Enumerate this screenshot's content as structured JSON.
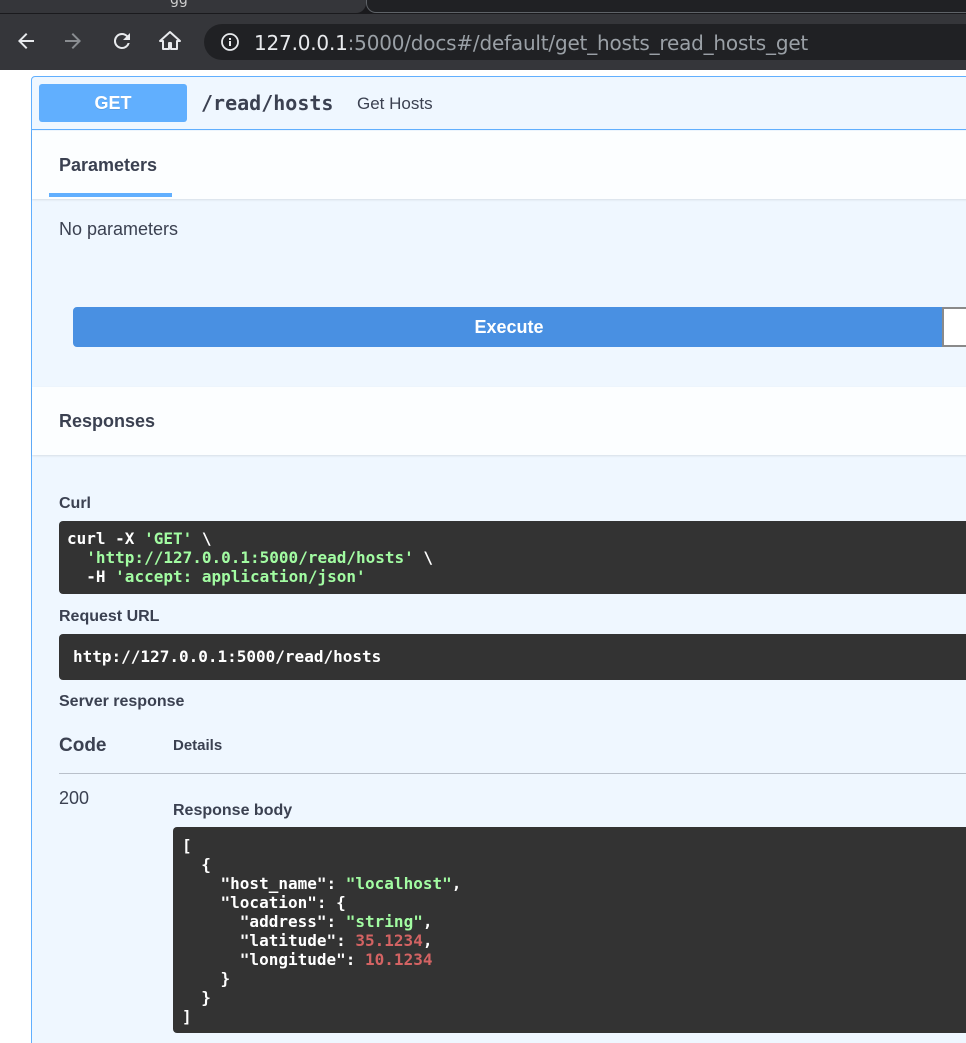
{
  "browser": {
    "tab_title": "gg",
    "url_host": "127.0.0.1",
    "url_rest": ":5000/docs#/default/get_hosts_read_hosts_get"
  },
  "operation": {
    "method": "GET",
    "path": "/read/hosts",
    "summary": "Get Hosts"
  },
  "parameters": {
    "tab_label": "Parameters",
    "empty_text": "No parameters",
    "execute_label": "Execute"
  },
  "responses": {
    "title": "Responses",
    "curl_label": "Curl",
    "curl_lines": [
      {
        "plain": "curl -X ",
        "str": "'GET'",
        "tail": " \\"
      },
      {
        "plain": "  ",
        "str": "'http://127.0.0.1:5000/read/hosts'",
        "tail": " \\"
      },
      {
        "plain": "  -H ",
        "str": "'accept: application/json'",
        "tail": ""
      }
    ],
    "request_url_label": "Request URL",
    "request_url": "http://127.0.0.1:5000/read/hosts",
    "server_response_label": "Server response",
    "col_code": "Code",
    "col_details": "Details",
    "status_code": "200",
    "response_body_label": "Response body",
    "response_body": {
      "open_array": "[",
      "open_obj": "  {",
      "host_name_key": "    \"host_name\": ",
      "host_name_val": "\"localhost\"",
      "location_key": "    \"location\": {",
      "address_key": "      \"address\": ",
      "address_val": "\"string\"",
      "latitude_key": "      \"latitude\": ",
      "latitude_val": "35.1234",
      "longitude_key": "      \"longitude\": ",
      "longitude_val": "10.1234",
      "close_location": "    }",
      "close_obj": "  }",
      "close_array": "]"
    }
  },
  "colors": {
    "get_blue": "#61affe",
    "execute_blue": "#4990e2",
    "code_bg": "#333333",
    "json_string": "#a2fca2",
    "json_number": "#d36363"
  }
}
